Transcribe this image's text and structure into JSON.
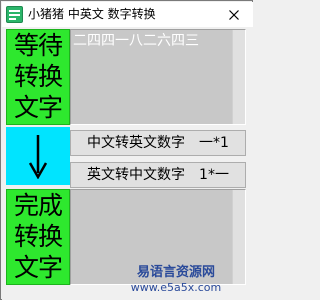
{
  "window": {
    "title": "小猪猪 中英文 数字转换",
    "app_icon": "app-logo-icon",
    "close_icon": "close-icon"
  },
  "pending": {
    "label_line1": "等待",
    "label_line2": "转换",
    "label_line3": "文字",
    "text": "二四四一八二六四三",
    "label_color": "#2ee82e"
  },
  "direction": {
    "icon": "down-arrow-icon",
    "panel_color": "#00e4ff"
  },
  "buttons": {
    "cn_to_en_label": "中文转英文数字　一*1",
    "en_to_cn_label": "英文转中文数字　1*一"
  },
  "done": {
    "label_line1": "完成",
    "label_line2": "转换",
    "label_line3": "文字",
    "text": ""
  },
  "watermark": {
    "name": "易语言资源网",
    "url": "www.e5a5x.com"
  }
}
